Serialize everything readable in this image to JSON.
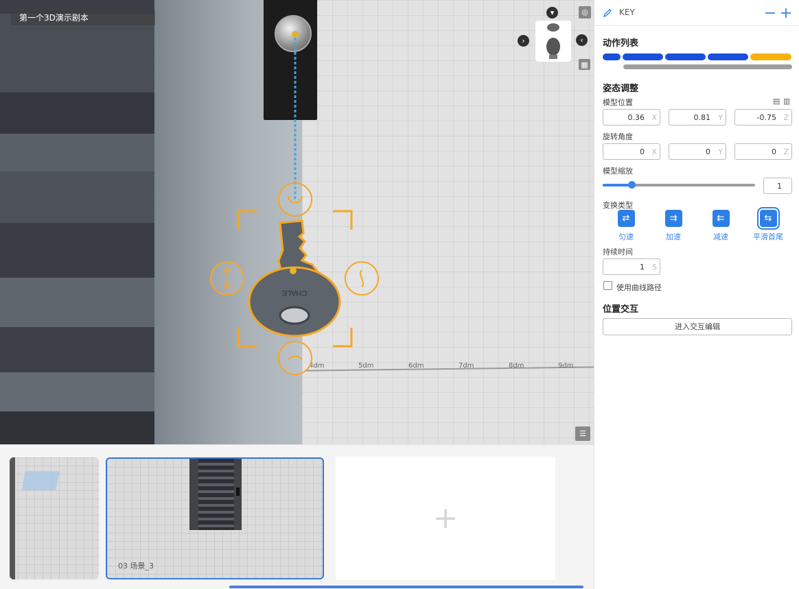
{
  "viewport": {
    "scene_title": "第一个3D演示剧本",
    "ruler_labels": [
      "4dm",
      "5dm",
      "6dm",
      "7dm",
      "8dm",
      "9dm"
    ],
    "key_engraving": "CHALE",
    "accent_color": "#f5a623"
  },
  "timeline": {
    "thumb_2_label": "03  场景_3",
    "add_symbol": "+",
    "selection_color": "#3a7bdc"
  },
  "panel": {
    "object_name": "KEY",
    "action_list_title": "动作列表",
    "action_segment_colors": [
      "#1a4fdd",
      "#1a4fdd",
      "#1a4fdd",
      "#1a4fdd",
      "#f5b20e"
    ],
    "pose_title": "姿态调整",
    "position_label": "模型位置",
    "position": {
      "x": "0.36",
      "y": "0.81",
      "z": "-0.75"
    },
    "rotation_label": "旋转角度",
    "rotation": {
      "x": "0",
      "y": "0",
      "z": "0"
    },
    "axis_x": "X",
    "axis_y": "Y",
    "axis_z": "Z",
    "scale_label": "模型缩放",
    "scale_value": "1",
    "scale_slider_fraction": 0.19,
    "transform_label": "变换类型",
    "transform_types": [
      "匀速",
      "加速",
      "减速",
      "平滑首尾"
    ],
    "transform_selected": "平滑首尾",
    "duration_label": "持续时间",
    "duration_value": "1",
    "duration_unit": "S",
    "curve_path_label": "使用曲线路径",
    "curve_path_checked": false,
    "interaction_title": "位置交互",
    "interaction_button": "进入交互编辑"
  }
}
